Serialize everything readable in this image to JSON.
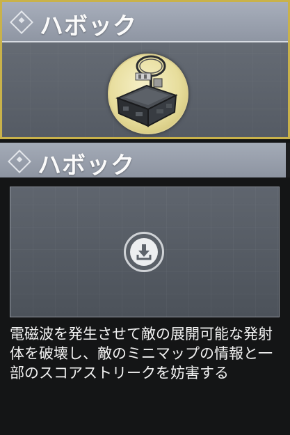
{
  "card": {
    "title": "ハボック",
    "selected": true,
    "border_color": "#c9b24a",
    "item_icon": "havoc-emp-device-icon"
  },
  "section": {
    "title": "ハボック"
  },
  "preview": {
    "action_icon": "download-icon"
  },
  "description": "電磁波を発生させて敵の展開可能な発射体を破壊し、敵のミニマップの情報と一部のスコアストリークを妨害する"
}
